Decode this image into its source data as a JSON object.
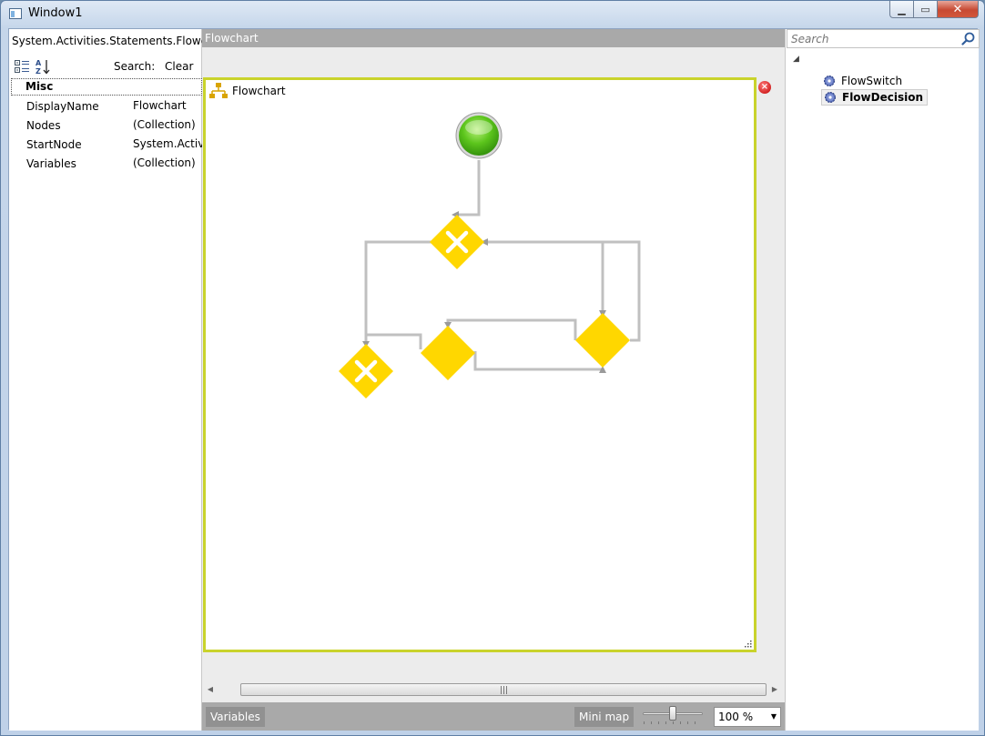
{
  "window": {
    "title": "Window1"
  },
  "property_grid": {
    "type_name": "System.Activities.Statements.Flowchart",
    "search_label": "Search:",
    "clear_label": "Clear",
    "category": "Misc",
    "properties": [
      {
        "name": "DisplayName",
        "value": "Flowchart"
      },
      {
        "name": "Nodes",
        "value": "(Collection)"
      },
      {
        "name": "StartNode",
        "value": "System.Activities"
      },
      {
        "name": "Variables",
        "value": "(Collection)"
      }
    ]
  },
  "designer": {
    "breadcrumb": "Flowchart",
    "flowchart_title": "Flowchart",
    "variables_label": "Variables",
    "minimap_label": "Mini map",
    "zoom_value": "100 %",
    "zoom_level": 0.5,
    "colors": {
      "canvas_border": "#c9d32c",
      "decision": "#ffd700",
      "start": "#5cc51c",
      "connector": "#c0c0c0"
    }
  },
  "toolbox": {
    "search_placeholder": "Search",
    "items": [
      {
        "label": "FlowSwitch",
        "selected": false
      },
      {
        "label": "FlowDecision",
        "selected": true
      }
    ]
  }
}
